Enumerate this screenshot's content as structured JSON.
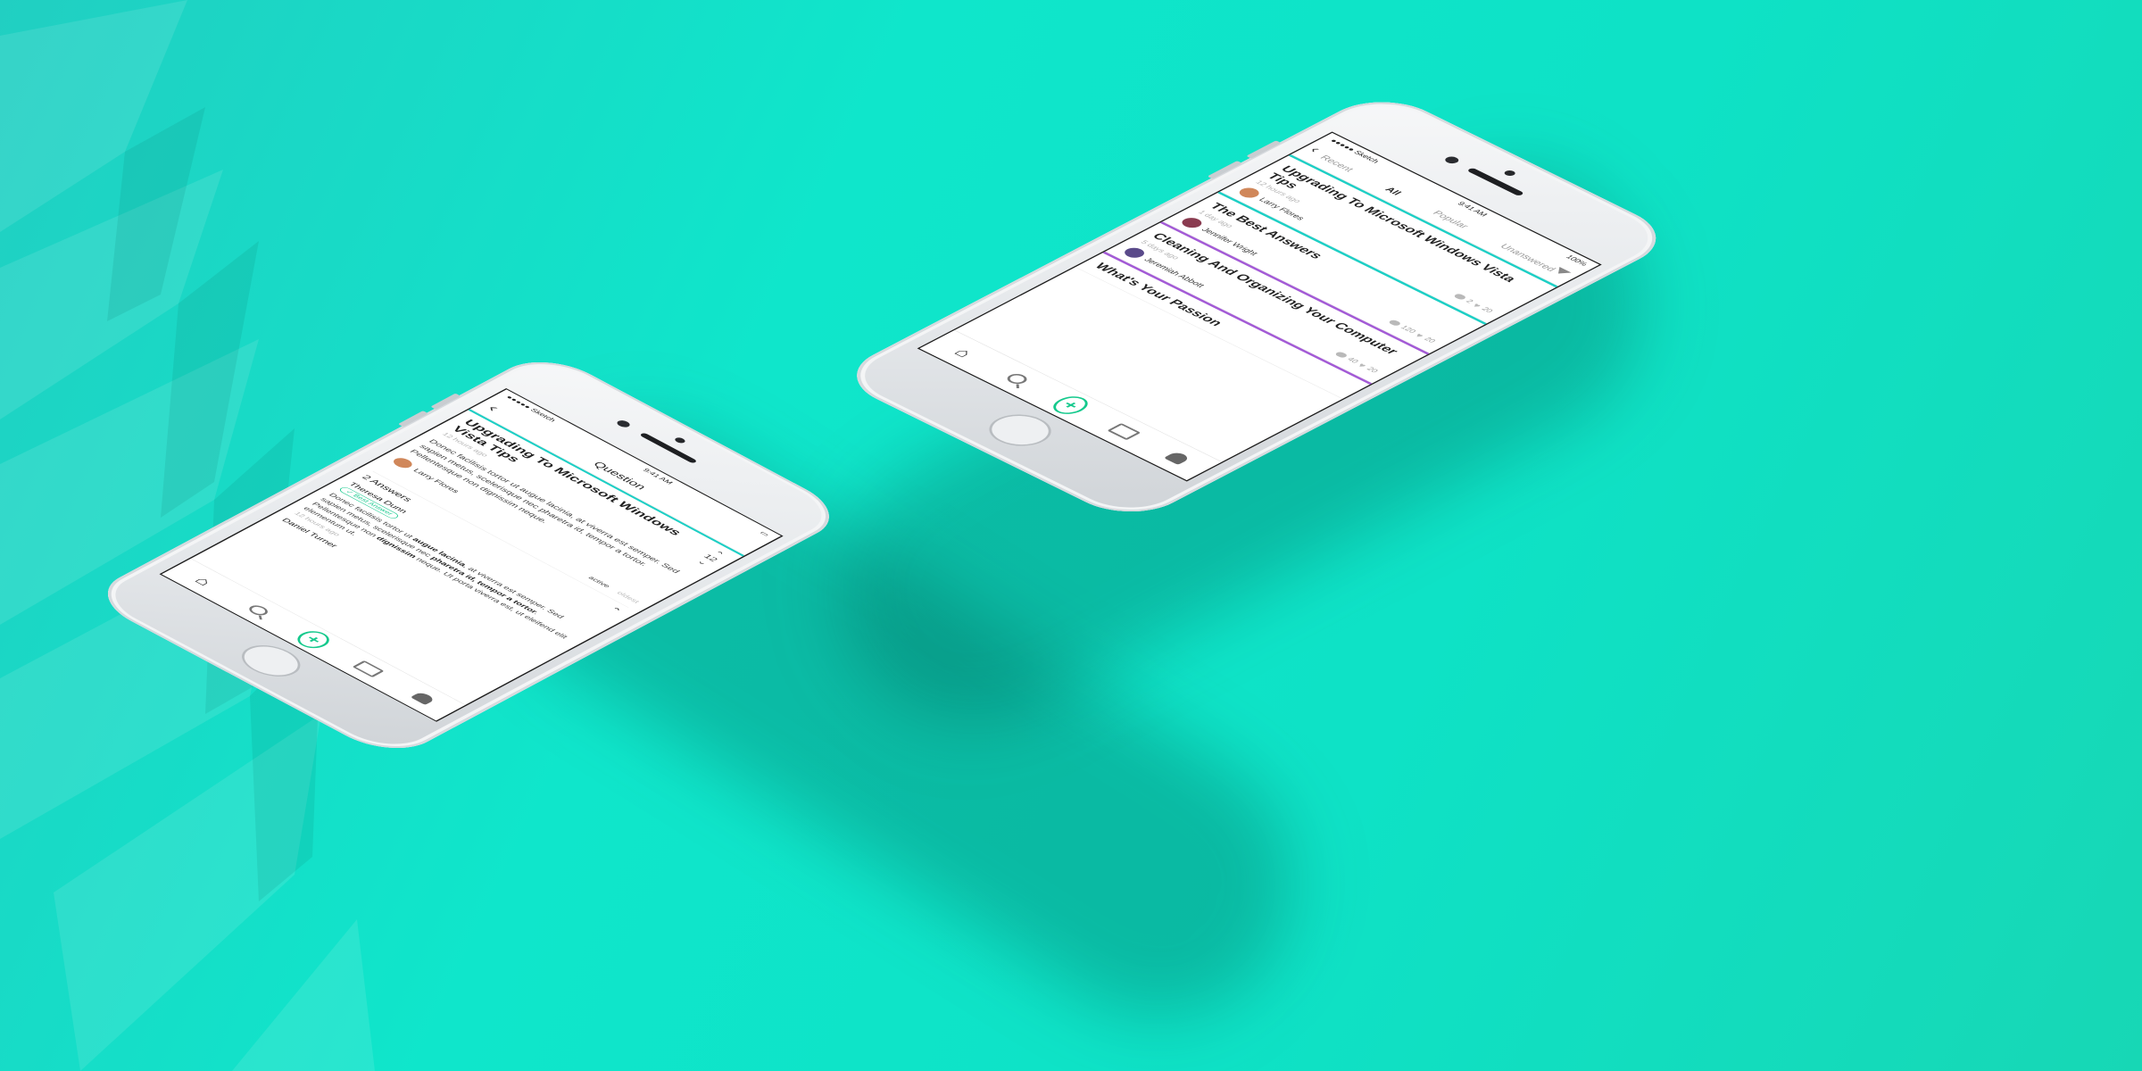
{
  "colors": {
    "teal_accent": "#1ccfc5",
    "purple_accent": "#a35ad6",
    "green_action": "#14c98c",
    "background": "#0fe6cb"
  },
  "feed_phone": {
    "status": {
      "carrier": "●●●●● Sketch",
      "time": "9:41 AM",
      "battery": "100%"
    },
    "tabs": [
      "Recent",
      "All",
      "Popular",
      "Unanswered"
    ],
    "active_tab": "All",
    "filter_icon": "filter-icon",
    "posts": [
      {
        "title": "Upgrading To Microsoft Windows Vista Tips",
        "time": "12 hours ago",
        "author": "Larry Flores",
        "comments": "2",
        "likes": "20"
      },
      {
        "title": "The Best Answers",
        "time": "1 day ago",
        "author": "Jennifer Wright",
        "comments": "120",
        "likes": "20"
      },
      {
        "title": "Cleaning And Organizing Your Computer",
        "time": "5 days ago",
        "author": "Jeremiah Abbott",
        "comments": "40",
        "likes": "20"
      },
      {
        "title": "What's Your Passion"
      }
    ],
    "tab_bar": [
      "house-icon",
      "search-icon",
      "add-button",
      "inbox-icon",
      "profile-icon"
    ]
  },
  "question_phone": {
    "status": {
      "carrier": "●●●●● Sketch",
      "time": "9:41 AM"
    },
    "nav_title": "Question",
    "question": {
      "title": "Upgrading To Microsoft Windows Vista Tips",
      "time": "12 hours ago",
      "body": "Donec facilisis tortor ut augue lacinia, at viverra est semper. Sed sapien metus, scelerisque nec pharetra id, tempor a tortor. Pellentesque non dignissim neque.",
      "author": "Larry Flores",
      "votes": "12"
    },
    "sort": [
      "active",
      "oldest"
    ],
    "answers_count": "2 Answers",
    "answers": [
      {
        "name": "Theresa Dunn",
        "badge": "Best Answer",
        "text_start": "Donec facilisis tortor ut ",
        "text_bold1": "augue lacinia",
        "text_mid1": ", at viverra est semper. Sed sapien metus, scelerisque nec ",
        "text_bold2": "pharetra id, tempor a tortor",
        "text_mid2": ". Pellentesque non ",
        "text_bold3": "dignissim",
        "text_end": " neque. Ut porta viverra est, ut eleifend elit elementum ut.",
        "time": "12 hours ago"
      },
      {
        "name": "Daniel Turner"
      }
    ],
    "tab_bar": [
      "house-icon",
      "search-icon",
      "add-button",
      "inbox-icon",
      "profile-icon"
    ]
  }
}
